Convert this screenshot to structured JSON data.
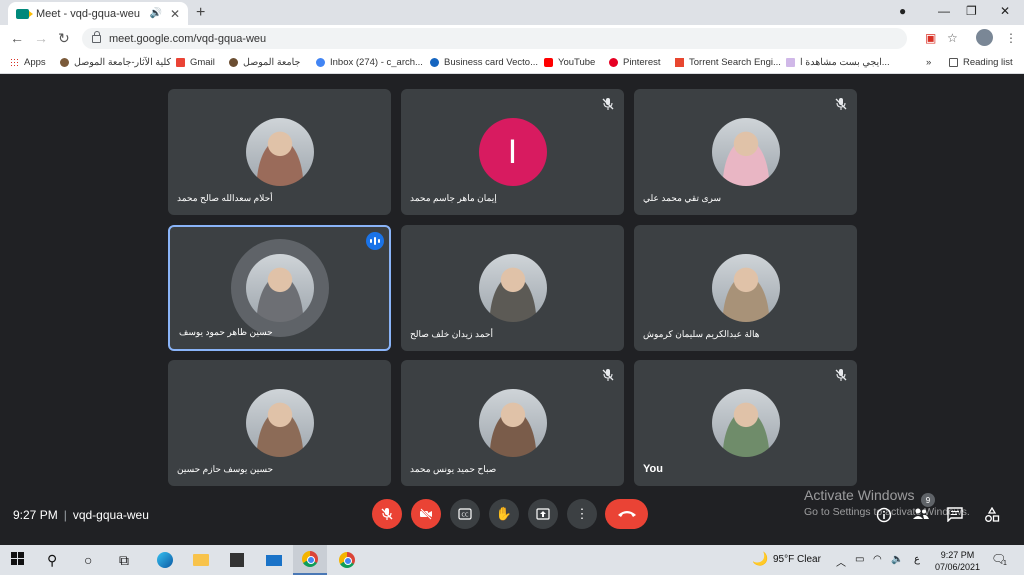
{
  "browser": {
    "tab_title": "Meet - vqd-gqua-weu",
    "url": "meet.google.com/vqd-gqua-weu",
    "bookmarks": [
      "Apps",
      "كلية الآثار-جامعة الموصل",
      "Gmail",
      "جامعة الموصل",
      "Inbox (274) - c_arch...",
      "Business card Vecto...",
      "YouTube",
      "Pinterest",
      "Torrent Search Engi...",
      "ايجي بست مشاهدة ا...",
      "Reading list"
    ]
  },
  "meet": {
    "time": "9:27 PM",
    "meeting_code": "vqd-gqua-weu",
    "participant_count": "9",
    "participants": [
      {
        "name": "أحلام سعدالله صالح محمد",
        "muted": false,
        "avatar": "photo",
        "color": "#9a6b5a"
      },
      {
        "name": "إيمان ماهر جاسم محمد",
        "muted": true,
        "avatar": "initial",
        "initial": "I",
        "color": "#d81b60"
      },
      {
        "name": "سرى تقي محمد علي",
        "muted": true,
        "avatar": "photo",
        "color": "#e9b6c4"
      },
      {
        "name": "حسين ظاهر حمود يوسف",
        "muted": false,
        "avatar": "photo",
        "speaking": true,
        "color": "#6d6f74"
      },
      {
        "name": "أحمد زيدان خلف صالح",
        "muted": false,
        "avatar": "photo",
        "color": "#5c5a55"
      },
      {
        "name": "هالة عبدالكريم سليمان كرموش",
        "muted": false,
        "avatar": "photo",
        "color": "#a89278"
      },
      {
        "name": "حسين يوسف حازم حسين",
        "muted": false,
        "avatar": "photo",
        "color": "#8c6b57"
      },
      {
        "name": "صباح حميد يونس محمد",
        "muted": true,
        "avatar": "photo",
        "color": "#7a5c4a"
      },
      {
        "name": "You",
        "muted": true,
        "avatar": "photo",
        "color": "#6f8c6a"
      }
    ]
  },
  "windows_watermark": {
    "line1": "Activate Windows",
    "line2": "Go to Settings to activate Windows."
  },
  "taskbar": {
    "weather": "95°F  Clear",
    "lang": "ع",
    "time": "9:27 PM",
    "date": "07/06/2021",
    "notifications": "1"
  }
}
